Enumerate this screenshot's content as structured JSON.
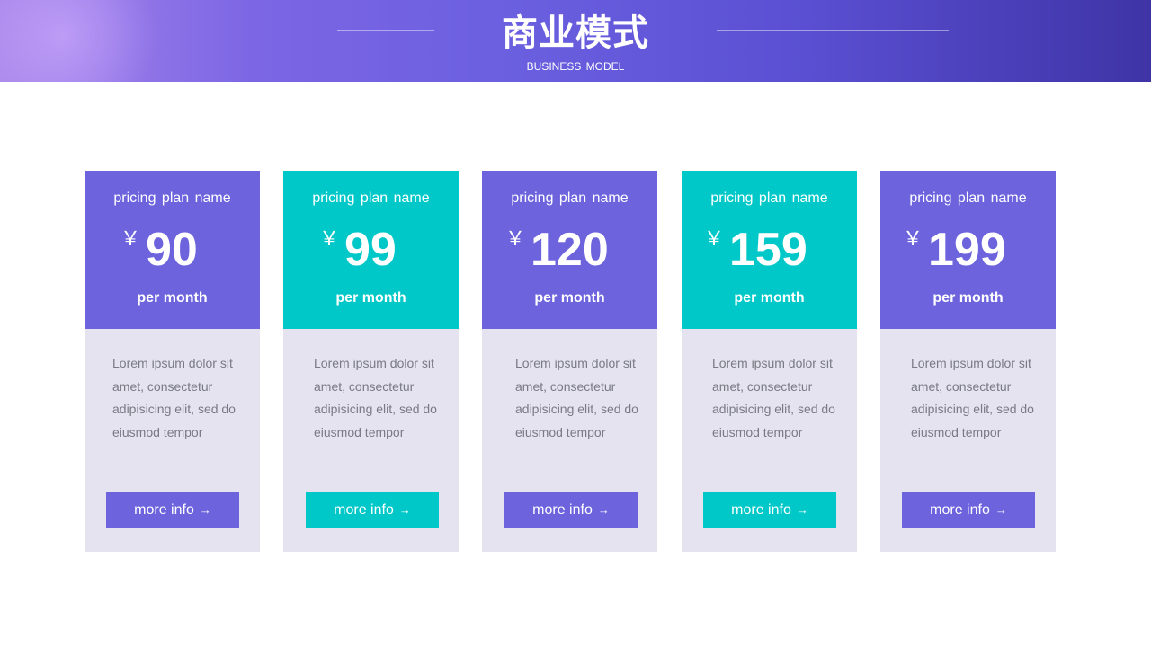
{
  "header": {
    "title": "商业模式",
    "subtitle": "BUSINESS MODEL"
  },
  "colors": {
    "purple": "#6c63dd",
    "teal": "#00c8c8",
    "card_body": "#e4e3ef"
  },
  "cards": [
    {
      "plan_name": "pricing plan  name",
      "currency": "￥",
      "price": "90",
      "period": "per month",
      "description": "Lorem ipsum dolor sit amet, consectetur adipisicing elit, sed do eiusmod tempor",
      "button_label": "more info",
      "button_icon": "arrow-right-icon",
      "theme": "purple"
    },
    {
      "plan_name": "pricing plan  name",
      "currency": "￥",
      "price": "99",
      "period": "per month",
      "description": "Lorem ipsum dolor sit amet, consectetur adipisicing elit, sed do eiusmod tempor",
      "button_label": "more info",
      "button_icon": "arrow-right-icon",
      "theme": "teal"
    },
    {
      "plan_name": "pricing plan  name",
      "currency": "￥",
      "price": "120",
      "period": "per month",
      "description": "Lorem ipsum dolor sit amet, consectetur adipisicing elit, sed do eiusmod tempor",
      "button_label": "more info",
      "button_icon": "arrow-right-icon",
      "theme": "purple"
    },
    {
      "plan_name": "pricing plan  name",
      "currency": "￥",
      "price": "159",
      "period": "per month",
      "description": "Lorem ipsum dolor sit amet, consectetur adipisicing elit, sed do eiusmod tempor",
      "button_label": "more info",
      "button_icon": "arrow-right-icon",
      "theme": "teal"
    },
    {
      "plan_name": "pricing plan  name",
      "currency": "￥",
      "price": "199",
      "period": "per month",
      "description": "Lorem ipsum dolor sit amet, consectetur adipisicing elit, sed do eiusmod tempor",
      "button_label": "more info",
      "button_icon": "arrow-right-icon",
      "theme": "purple"
    }
  ]
}
